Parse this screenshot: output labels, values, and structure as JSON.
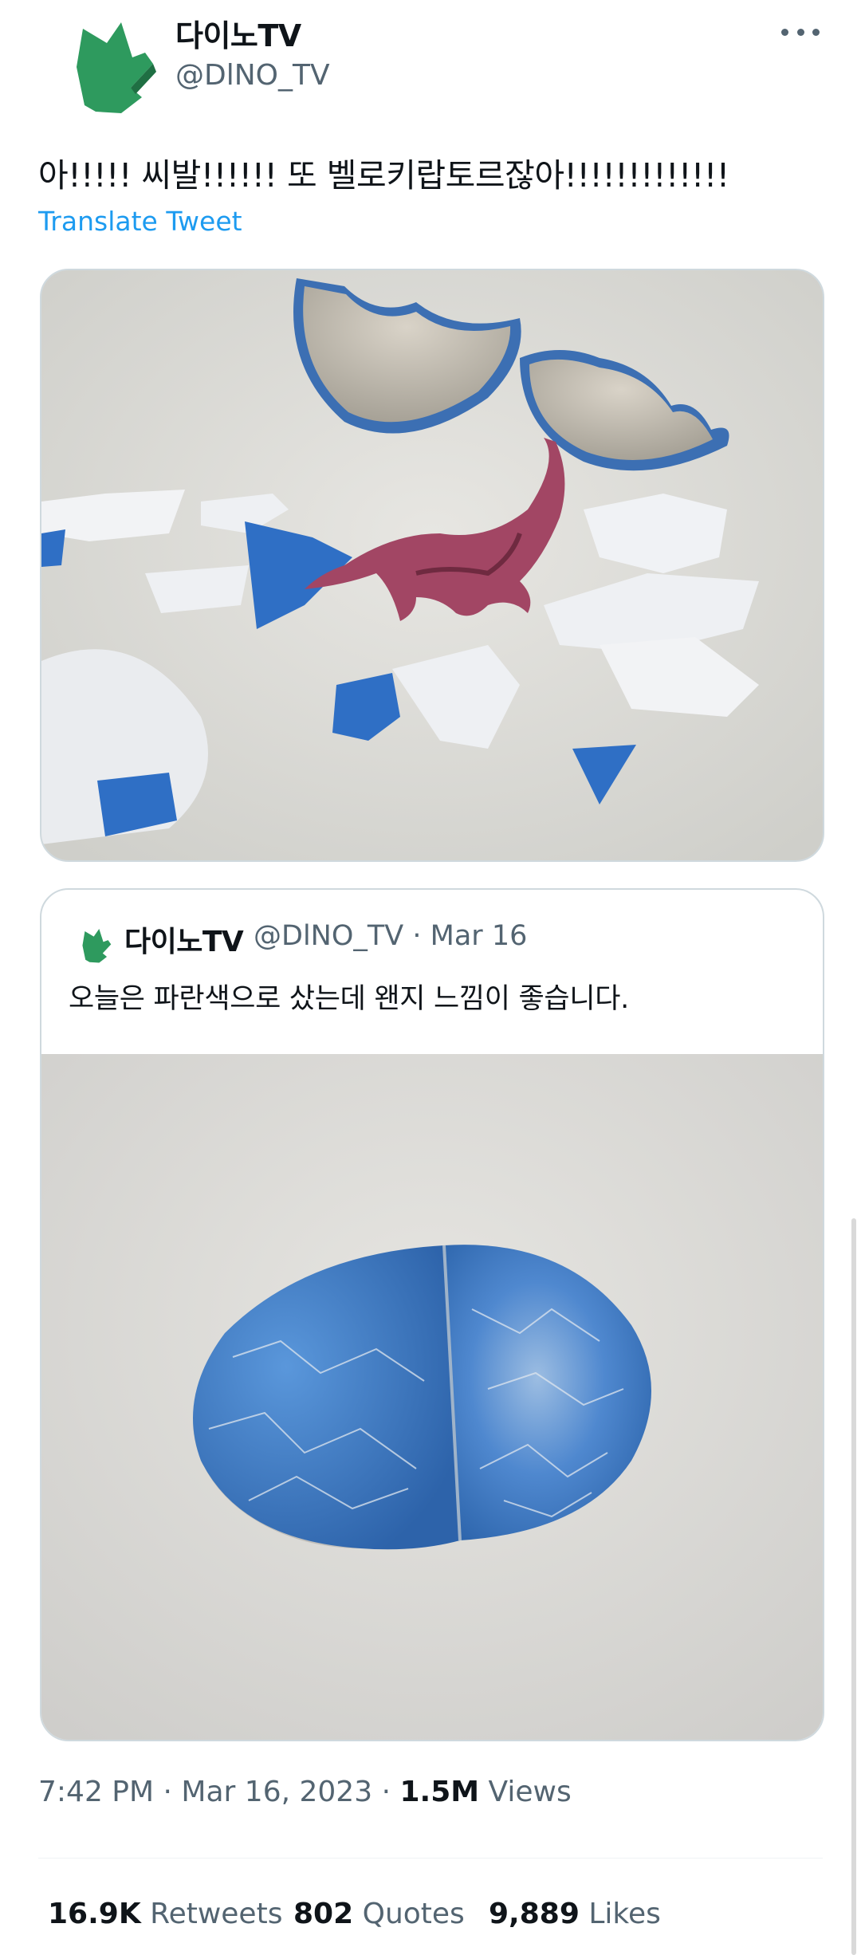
{
  "author": {
    "name": "다이노TV",
    "handle": "@DlNO_TV",
    "avatar_icon": "green-dinosaur-foot-icon"
  },
  "tweet": {
    "text": "아!!!!! 씨발!!!!!! 또 벨로키랍토르잖아!!!!!!!!!!!!!",
    "translate_label": "Translate Tweet"
  },
  "media": {
    "image_1": "broken blue egg shell with pink dinosaur figure",
    "image_2": "blue crackle-patterned toy egg"
  },
  "quoted": {
    "name": "다이노TV",
    "handle": "@DlNO_TV",
    "separator": "·",
    "date": "Mar 16",
    "text": "오늘은 파란색으로 샀는데 왠지 느낌이 좋습니다."
  },
  "meta": {
    "time": "7:42 PM",
    "sep1": "·",
    "date": "Mar 16, 2023",
    "sep2": "·",
    "views_count": "1.5M",
    "views_label": "Views"
  },
  "stats": {
    "retweets_count": "16.9K",
    "retweets_label": "Retweets",
    "quotes_count": "802",
    "quotes_label": "Quotes",
    "likes_count": "9,889",
    "likes_label": "Likes"
  },
  "colors": {
    "link": "#1d9bf0",
    "secondary_text": "#536471",
    "primary_text": "#0f1419",
    "avatar_green": "#2e9a5e"
  }
}
